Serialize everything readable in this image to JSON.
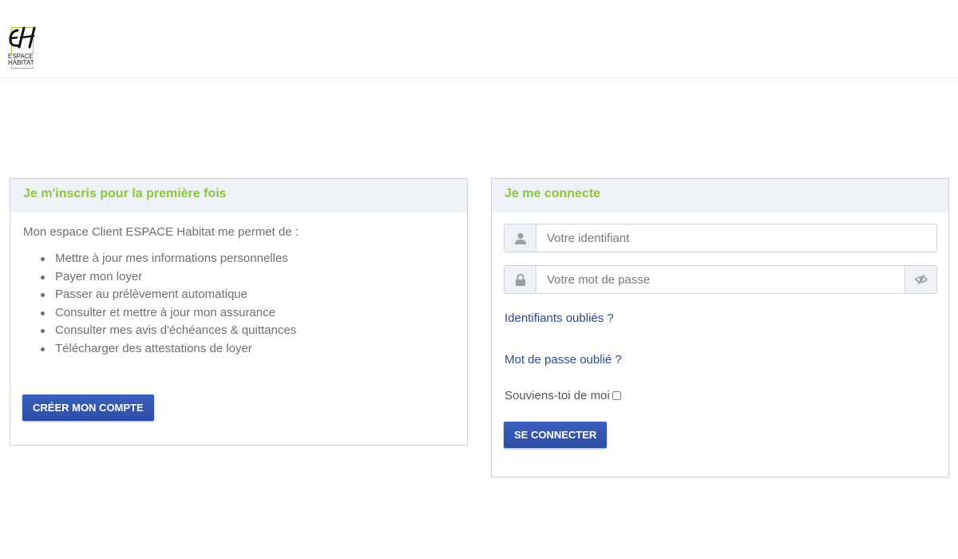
{
  "header": {
    "logo_mark": "EH",
    "logo_line1": "ESPACE",
    "logo_line2": "HABITAT"
  },
  "signup": {
    "title": "Je m'inscris pour la première fois",
    "intro": "Mon espace Client ESPACE Habitat me permet de :",
    "features": [
      "Mettre à jour mes informations personnelles",
      "Payer mon loyer",
      "Passer au prélèvement automatique",
      "Consulter et mettre à jour mon assurance",
      "Consulter mes avis d'échéances & quittances",
      "Télécharger des attestations de loyer"
    ],
    "button_label": "CRÉER MON COMPTE"
  },
  "login": {
    "title": "Je me connecte",
    "username_placeholder": "Votre identifiant",
    "username_value": "",
    "password_placeholder": "Votre mot de passe",
    "password_value": "",
    "forgot_ids": "Identifiants oubliés ?",
    "forgot_password": "Mot de passe oublié ?",
    "remember_label": "Souviens-toi de moi",
    "remember_checked": false,
    "button_label": "SE CONNECTER",
    "icons": {
      "user": "user-icon",
      "lock": "lock-icon",
      "toggle": "eye-slash-icon"
    }
  },
  "colors": {
    "accent_green": "#8cc63f",
    "button_blue": "#2d4ea6",
    "link_blue": "#2f4a8a",
    "panel_header_bg": "#eef1f5"
  }
}
